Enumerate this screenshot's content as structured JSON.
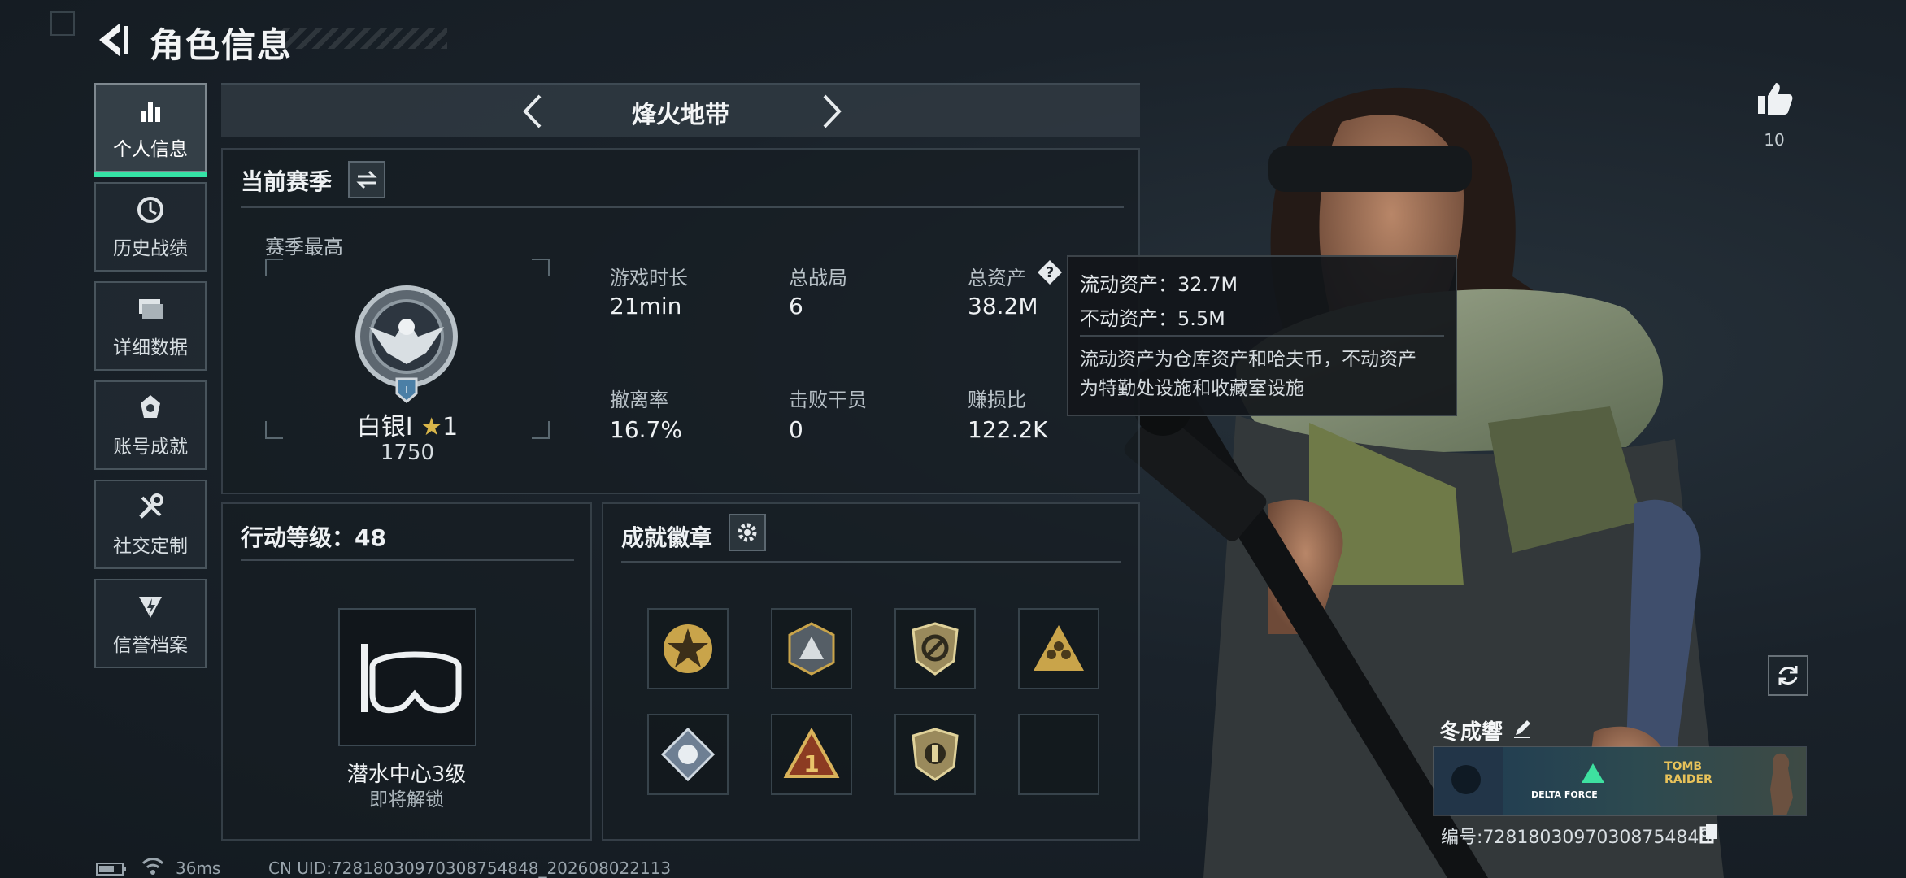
{
  "header": {
    "title": "角色信息"
  },
  "sidebar": {
    "items": [
      {
        "label": "个人信息",
        "icon": "bar-chart-icon",
        "active": true
      },
      {
        "label": "历史战绩",
        "icon": "history-icon",
        "active": false
      },
      {
        "label": "详细数据",
        "icon": "folder-icon",
        "active": false
      },
      {
        "label": "账号成就",
        "icon": "medal-icon",
        "active": false
      },
      {
        "label": "社交定制",
        "icon": "tools-icon",
        "active": false
      },
      {
        "label": "信誉档案",
        "icon": "shield-lightning-icon",
        "active": false
      }
    ]
  },
  "mode": {
    "label": "烽火地带"
  },
  "season": {
    "title": "当前赛季",
    "best_label": "赛季最高",
    "rank_name": "白银Ⅰ",
    "rank_stars": "1",
    "rank_score": "1750",
    "stats": [
      {
        "label": "游戏时长",
        "value": "21min"
      },
      {
        "label": "总战局",
        "value": "6"
      },
      {
        "label": "总资产",
        "value": "38.2M"
      },
      {
        "label": "撤离率",
        "value": "16.7%"
      },
      {
        "label": "击败干员",
        "value": "0"
      },
      {
        "label": "赚损比",
        "value": "122.2K"
      }
    ]
  },
  "tooltip": {
    "liquid": "流动资产：32.7M",
    "fixed": "不动资产：5.5M",
    "desc_line1": "流动资产为仓库资产和哈夫币，不动资产",
    "desc_line2": "为特勤处设施和收藏室设施"
  },
  "action_level": {
    "title": "行动等级：48",
    "facility_name": "潜水中心3级",
    "facility_status": "即将解锁"
  },
  "achievements": {
    "title": "成就徽章"
  },
  "player": {
    "name": "冬成響",
    "likes": "10",
    "id_text": "编号:7281803097030875484​8",
    "banner_text_1": "DELTA FORCE",
    "banner_text_2": "TOMB RAIDER"
  },
  "status_bar": {
    "ping": "36ms",
    "uid": "CN UID:7281803097030875484​8_202608022113"
  },
  "colors": {
    "accent": "#35e3a6",
    "gold": "#c9a44a"
  }
}
